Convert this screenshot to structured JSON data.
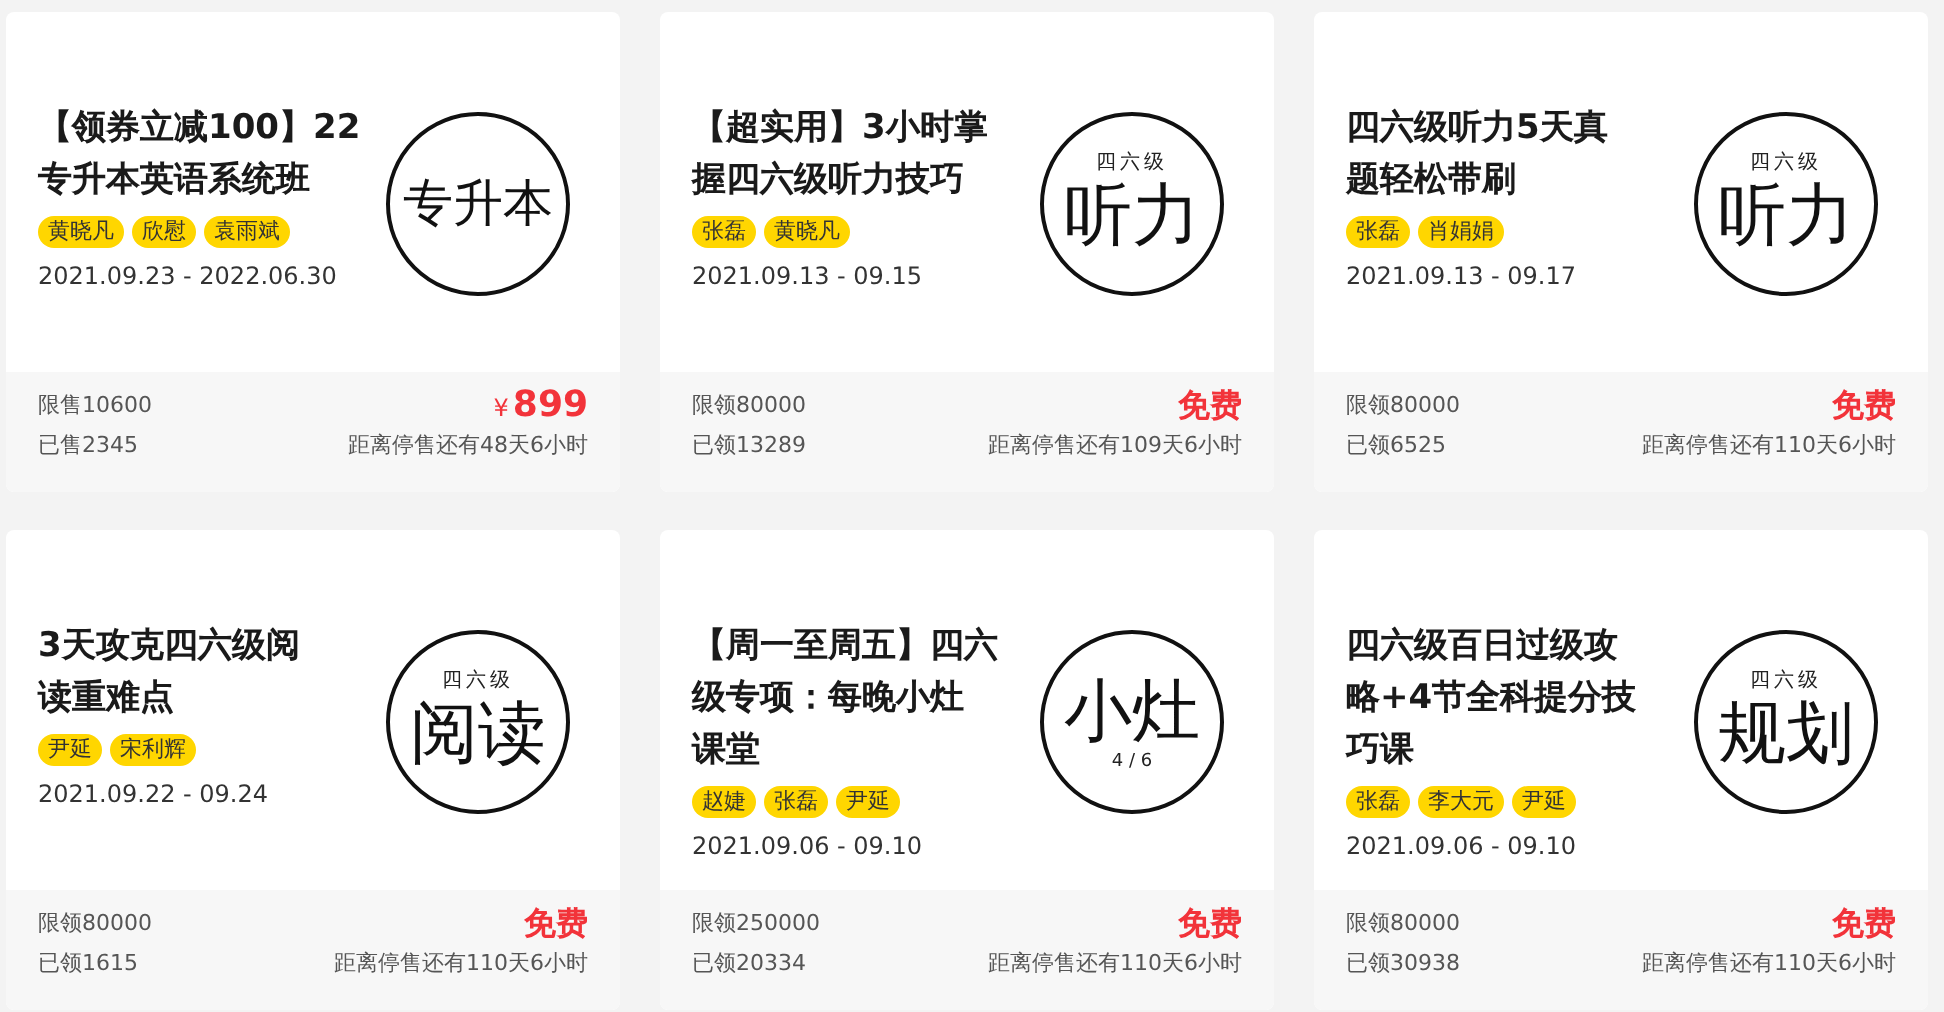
{
  "courses": [
    {
      "title_lines": [
        "【领券立减100】22",
        "专升本英语系统班"
      ],
      "teachers": [
        "黄晓凡",
        "欣慰",
        "袁雨斌"
      ],
      "date": "2021.09.23 - 2022.06.30",
      "emblem": {
        "main": "专升本"
      },
      "quota": "限售10600",
      "taken": "已售2345",
      "price": {
        "kind": "paid",
        "currency": "¥",
        "amount": "899"
      },
      "countdown": "距离停售还有48天6小时"
    },
    {
      "title_lines": [
        "【超实用】3小时掌",
        "握四六级听力技巧"
      ],
      "teachers": [
        "张磊",
        "黄晓凡"
      ],
      "date": "2021.09.13 - 09.15",
      "emblem": {
        "top": "四六级",
        "main": "听力"
      },
      "quota": "限领80000",
      "taken": "已领13289",
      "price": {
        "kind": "free",
        "amount": "免费"
      },
      "countdown": "距离停售还有109天6小时"
    },
    {
      "title_lines": [
        "四六级听力5天真",
        "题轻松带刷"
      ],
      "teachers": [
        "张磊",
        "肖娟娟"
      ],
      "date": "2021.09.13 - 09.17",
      "emblem": {
        "top": "四六级",
        "main": "听力"
      },
      "quota": "限领80000",
      "taken": "已领6525",
      "price": {
        "kind": "free",
        "amount": "免费"
      },
      "countdown": "距离停售还有110天6小时"
    },
    {
      "title_lines": [
        "3天攻克四六级阅",
        "读重难点"
      ],
      "teachers": [
        "尹延",
        "宋利辉"
      ],
      "date": "2021.09.22 - 09.24",
      "emblem": {
        "top": "四六级",
        "main": "阅读"
      },
      "quota": "限领80000",
      "taken": "已领1615",
      "price": {
        "kind": "free",
        "amount": "免费"
      },
      "countdown": "距离停售还有110天6小时"
    },
    {
      "title_lines": [
        "【周一至周五】四六",
        "级专项：每晚小灶",
        "课堂"
      ],
      "teachers": [
        "赵婕",
        "张磊",
        "尹延"
      ],
      "date": "2021.09.06 - 09.10",
      "emblem": {
        "main": "小灶",
        "bottom": "4 / 6"
      },
      "quota": "限领250000",
      "taken": "已领20334",
      "price": {
        "kind": "free",
        "amount": "免费"
      },
      "countdown": "距离停售还有110天6小时"
    },
    {
      "title_lines": [
        "四六级百日过级攻",
        "略+4节全科提分技",
        "巧课"
      ],
      "teachers": [
        "张磊",
        "李大元",
        "尹延"
      ],
      "date": "2021.09.06 - 09.10",
      "emblem": {
        "top": "四六级",
        "main": "规划"
      },
      "quota": "限领80000",
      "taken": "已领30938",
      "price": {
        "kind": "free",
        "amount": "免费"
      },
      "countdown": "距离停售还有110天6小时"
    }
  ]
}
